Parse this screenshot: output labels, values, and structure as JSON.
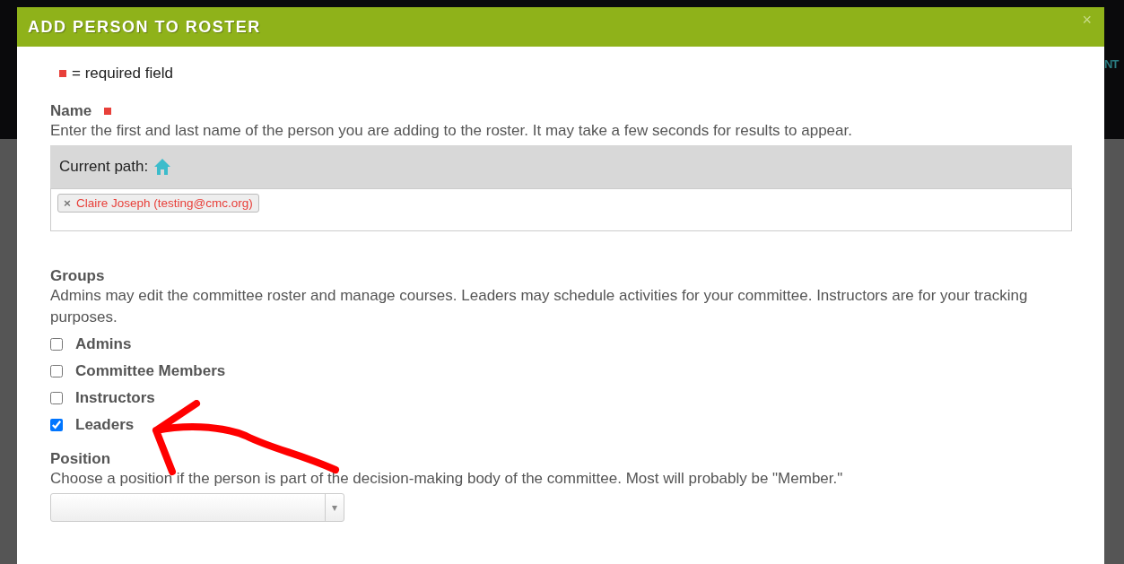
{
  "background": {
    "heading_fragment": "NT"
  },
  "dialog": {
    "title": "ADD PERSON TO ROSTER",
    "close": "×"
  },
  "legend": {
    "text": "= required field"
  },
  "name_field": {
    "label": "Name",
    "required": true,
    "help": "Enter the first and last name of the person you are adding to the roster. It may take a few seconds for results to appear.",
    "path_label": "Current path:",
    "tokens": [
      {
        "remove": "×",
        "text": "Claire Joseph (testing@cmc.org)"
      }
    ]
  },
  "groups": {
    "label": "Groups",
    "help": "Admins may edit the committee roster and manage courses. Leaders may schedule activities for your committee. Instructors are for your tracking purposes.",
    "options": [
      {
        "label": "Admins",
        "checked": false
      },
      {
        "label": "Committee Members",
        "checked": false
      },
      {
        "label": "Instructors",
        "checked": false
      },
      {
        "label": "Leaders",
        "checked": true
      }
    ]
  },
  "position": {
    "label": "Position",
    "help": "Choose a position if the person is part of the decision-making body of the committee. Most will probably be \"Member.\"",
    "select": {
      "caret": "▾"
    }
  }
}
